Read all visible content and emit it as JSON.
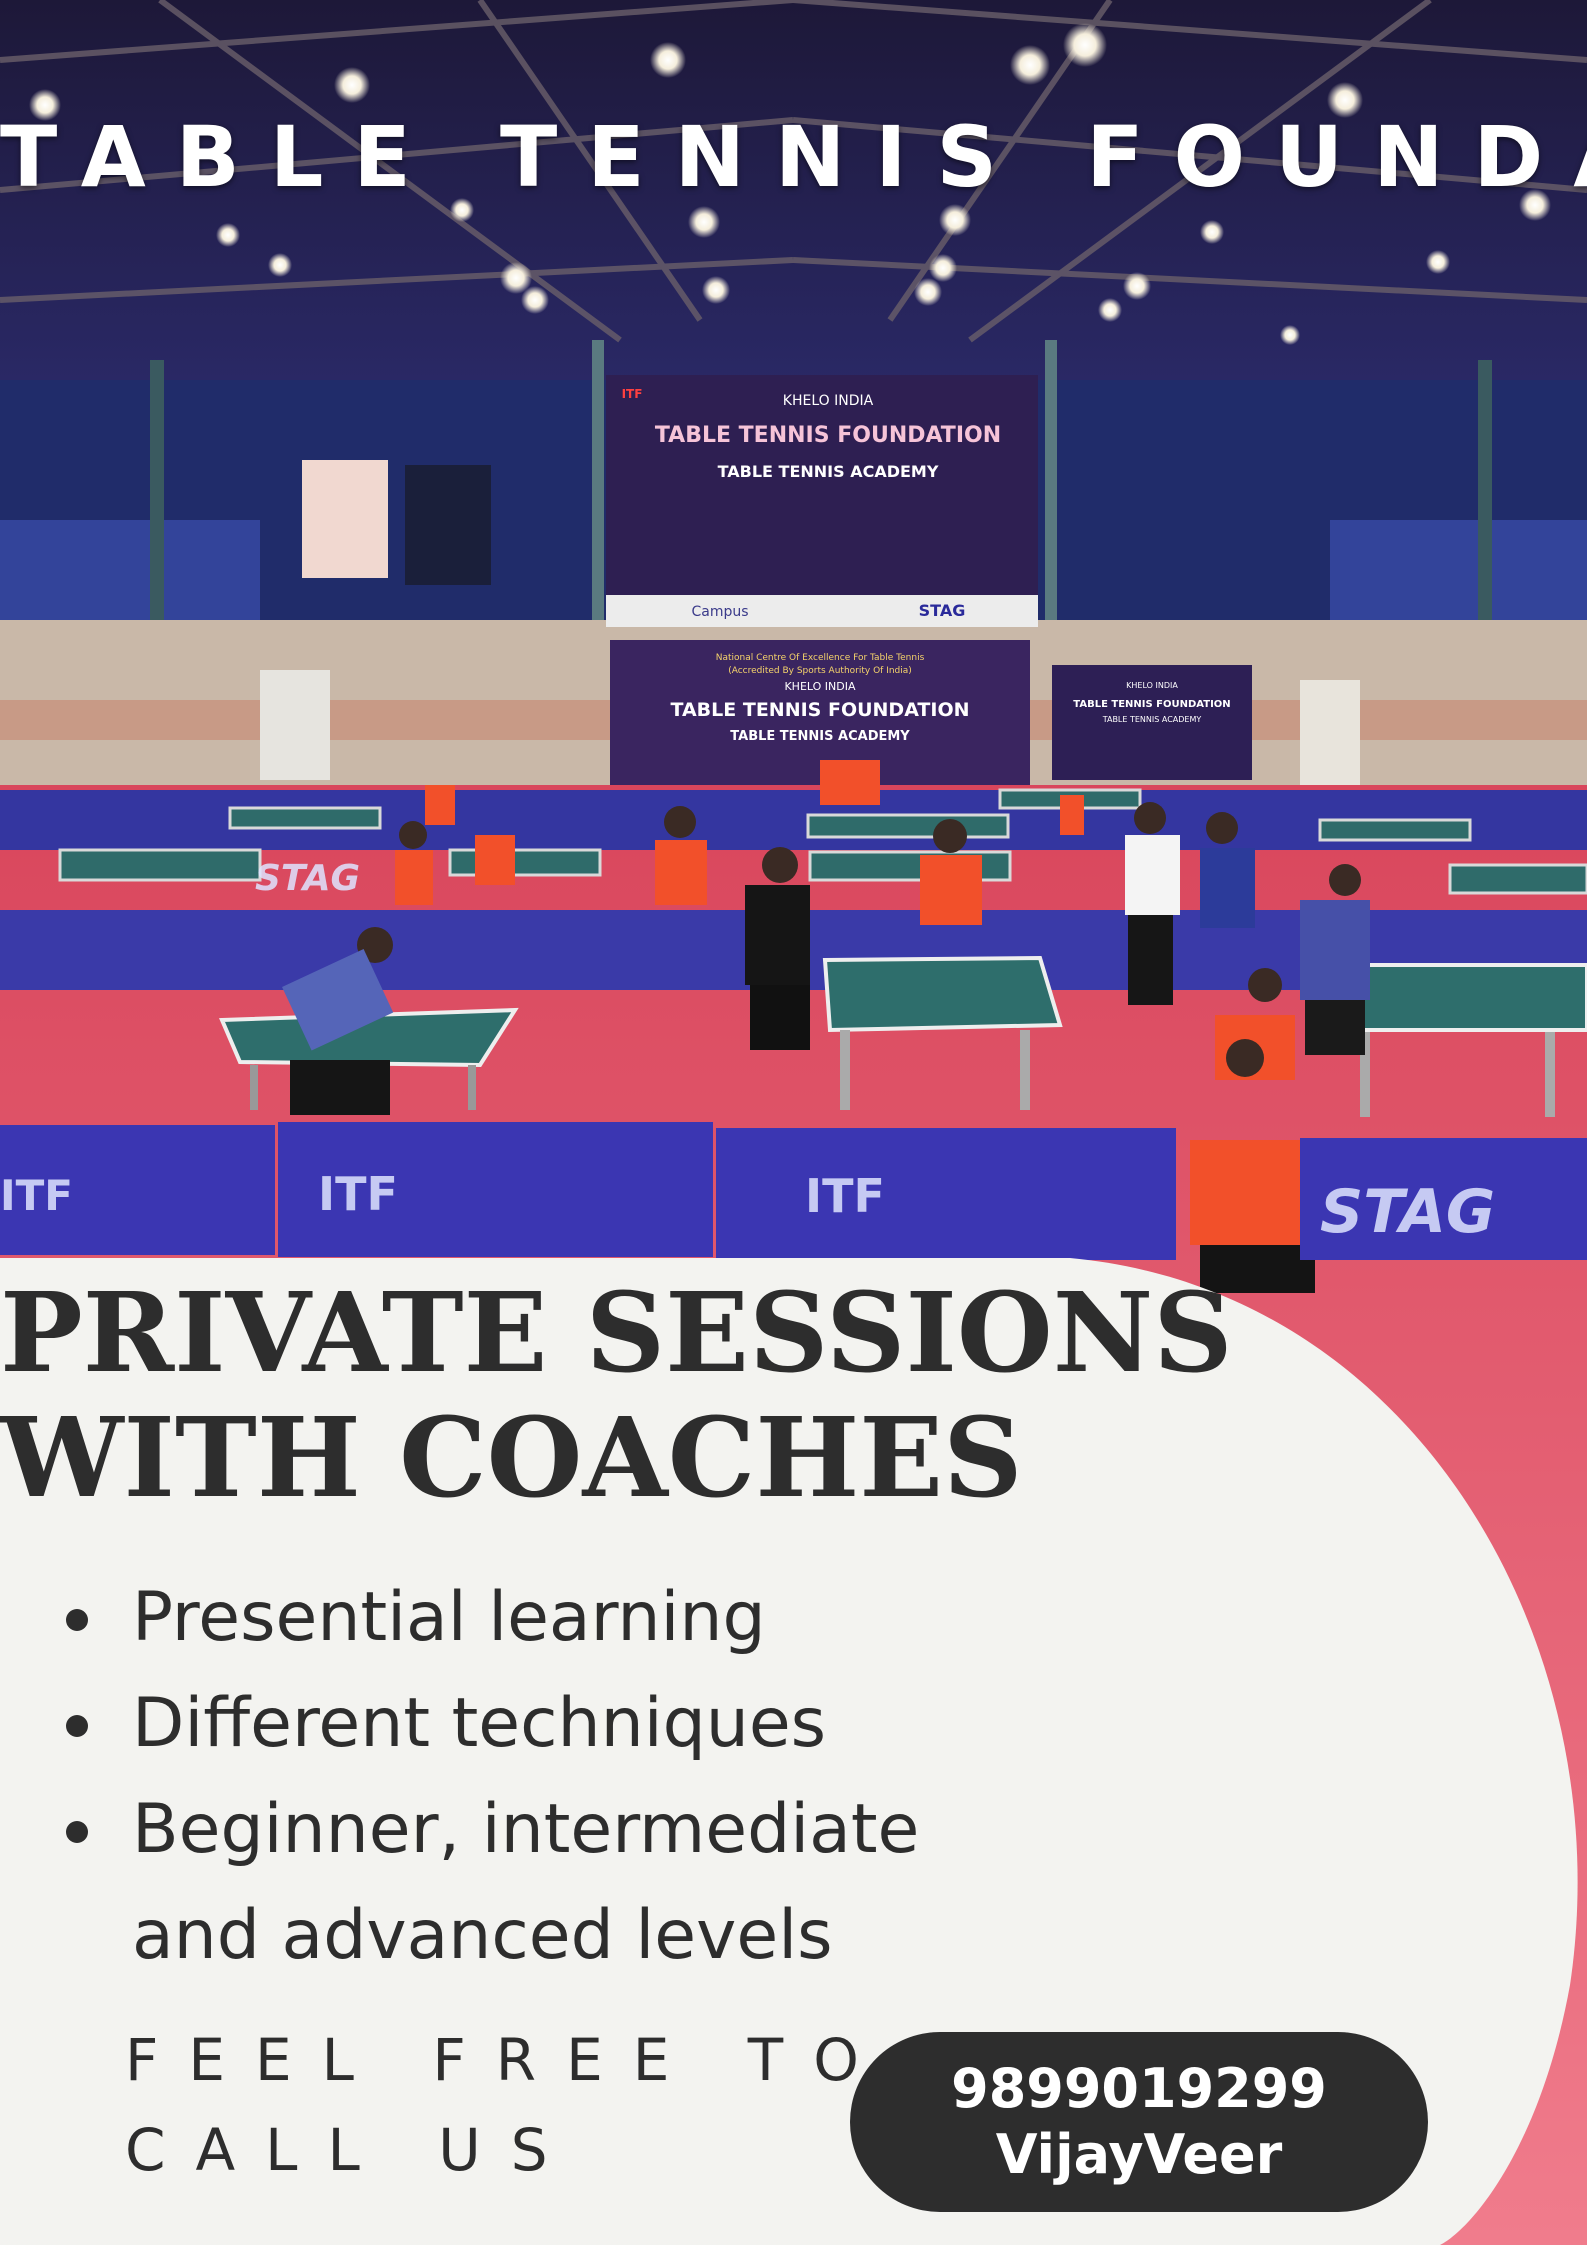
{
  "header": {
    "title": "TABLE TENNIS FOUNDATION"
  },
  "photo": {
    "banner_main": {
      "line1": "KHELO INDIA",
      "line2": "TABLE TENNIS FOUNDATION",
      "line3": "TABLE TENNIS ACADEMY",
      "logo": "ITF"
    },
    "banner_lower": {
      "line1": "National Centre Of Excellence For Table Tennis",
      "line2": "(Accredited By Sports Authority Of India)",
      "line3": "KHELO INDIA",
      "line4": "TABLE TENNIS FOUNDATION",
      "line5": "TABLE TENNIS ACADEMY"
    },
    "banner_right": {
      "line1": "KHELO INDIA",
      "line2": "TABLE TENNIS FOUNDATION",
      "line3": "TABLE TENNIS ACADEMY"
    },
    "sponsor_bar": {
      "left": "ITF",
      "right": "STAG",
      "mid": "Campus"
    },
    "barrier_labels": [
      "ITF",
      "ITF",
      "STAG",
      "STAG",
      "ITF"
    ]
  },
  "headline": {
    "line1": "PRIVATE SESSIONS",
    "line2": "WITH COACHES"
  },
  "features": [
    {
      "text": "Presential learning"
    },
    {
      "text": "Different techniques"
    },
    {
      "line1": "Beginner, intermediate",
      "line2": "and advanced levels"
    }
  ],
  "cta": {
    "line1": "FEEL FREE TO",
    "line2": "CALL US"
  },
  "contact": {
    "phone": "9899019299",
    "name": "VijayVeer"
  },
  "colors": {
    "panel": "#f3f3f0",
    "text_dark": "#2d2d2d",
    "floor": "#e0566a",
    "barrier": "#3a3aa8",
    "ceiling": "#241f4e"
  }
}
